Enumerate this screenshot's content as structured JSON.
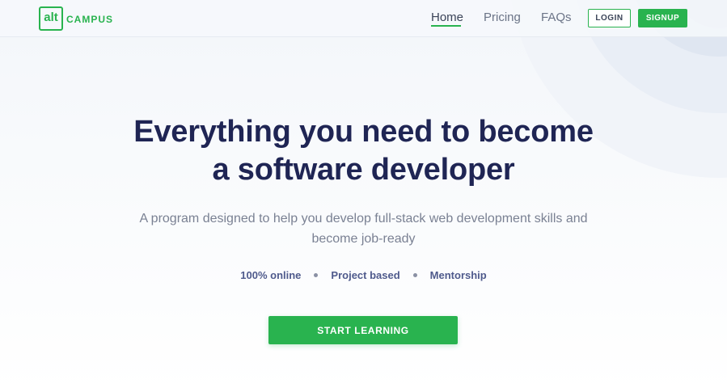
{
  "colors": {
    "brand_green": "#29b34f",
    "heading": "#1f2554",
    "subtext": "#7a8193",
    "feature_text": "#4f5a8c"
  },
  "header": {
    "logo_mark": "alt",
    "logo_text": "CAMPUS",
    "nav": [
      {
        "label": "Home",
        "active": true
      },
      {
        "label": "Pricing",
        "active": false
      },
      {
        "label": "FAQs",
        "active": false
      }
    ],
    "login_label": "LOGIN",
    "signup_label": "SIGNUP"
  },
  "hero": {
    "title_line1": "Everything you need to become",
    "title_line2": "a software developer",
    "subtitle_line1": "A program designed to help you develop full-stack web development skills and",
    "subtitle_line2": "become job-ready",
    "features": [
      "100% online",
      "Project based",
      "Mentorship"
    ],
    "cta_label": "START LEARNING"
  }
}
